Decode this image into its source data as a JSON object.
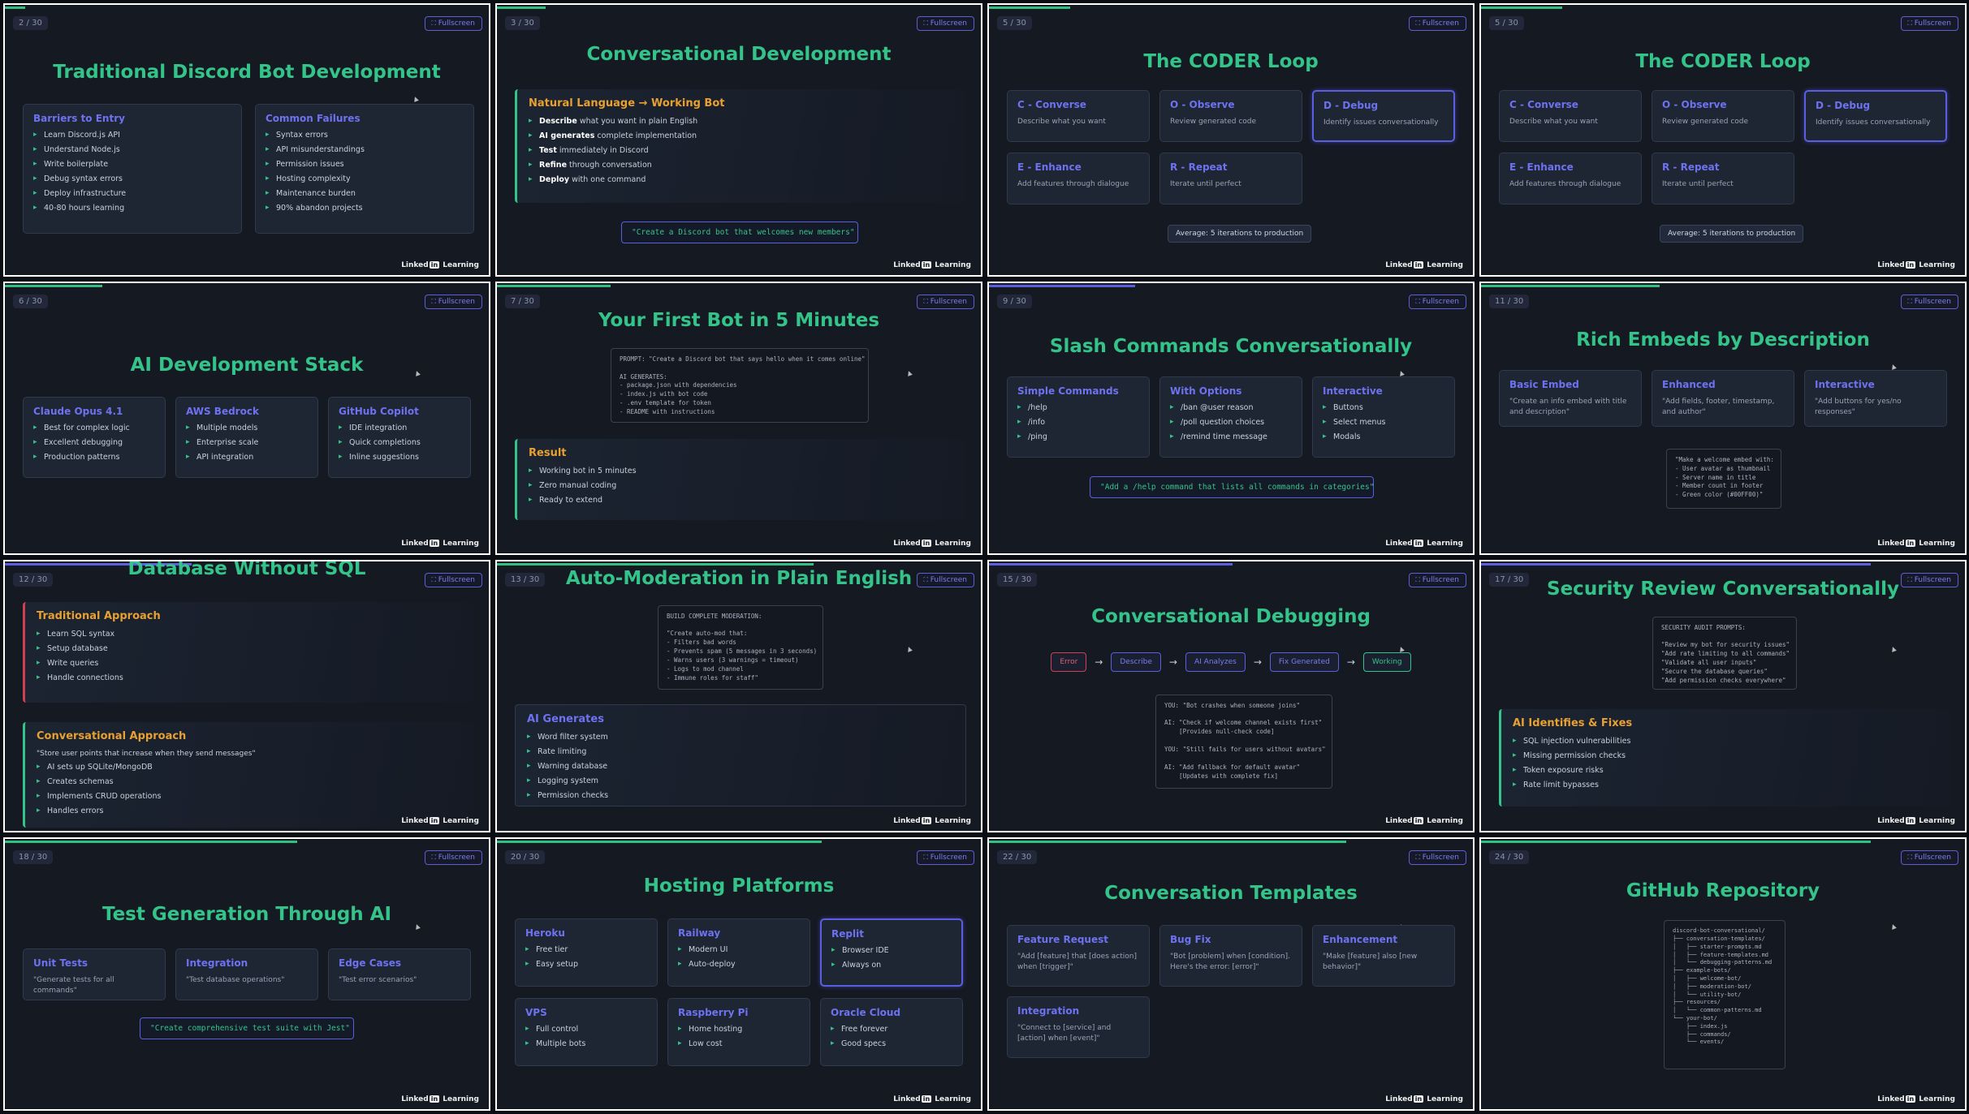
{
  "fullscreen_label": "Fullscreen",
  "brand": {
    "left": "Linked",
    "in": "in",
    "right": "Learning"
  },
  "slides": [
    {
      "num": "2 / 30",
      "title": "Traditional Discord Bot Development",
      "cards": [
        {
          "title": "Barriers to Entry",
          "items": [
            "Learn Discord.js API",
            "Understand Node.js",
            "Write boilerplate",
            "Debug syntax errors",
            "Deploy infrastructure",
            "40-80 hours learning"
          ]
        },
        {
          "title": "Common Failures",
          "items": [
            "Syntax errors",
            "API misunderstandings",
            "Permission issues",
            "Hosting complexity",
            "Maintenance burden",
            "90% abandon projects"
          ]
        }
      ]
    },
    {
      "num": "3 / 30",
      "title": "Conversational Development",
      "panel_title": "Natural Language → Working Bot",
      "items": [
        {
          "b": "Describe",
          "t": " what you want in plain English"
        },
        {
          "b": "AI generates",
          "t": " complete implementation"
        },
        {
          "b": "Test",
          "t": " immediately in Discord"
        },
        {
          "b": "Refine",
          "t": " through conversation"
        },
        {
          "b": "Deploy",
          "t": " with one command"
        }
      ],
      "prompt": "\"Create a Discord bot that welcomes new members\""
    },
    {
      "num": "5 / 30",
      "title": "The CODER Loop",
      "cards": [
        {
          "title": "C - Converse",
          "desc": "Describe what you want"
        },
        {
          "title": "O - Observe",
          "desc": "Review generated code"
        },
        {
          "title": "D - Debug",
          "desc": "Identify issues conversationally"
        },
        {
          "title": "E - Enhance",
          "desc": "Add features through dialogue"
        },
        {
          "title": "R - Repeat",
          "desc": "Iterate until perfect"
        }
      ],
      "chip": "Average: 5 iterations to production"
    },
    {
      "num": "5 / 30",
      "title": "The CODER Loop",
      "cards": [
        {
          "title": "C - Converse",
          "desc": "Describe what you want"
        },
        {
          "title": "O - Observe",
          "desc": "Review generated code"
        },
        {
          "title": "D - Debug",
          "desc": "Identify issues conversationally"
        },
        {
          "title": "E - Enhance",
          "desc": "Add features through dialogue"
        },
        {
          "title": "R - Repeat",
          "desc": "Iterate until perfect"
        }
      ],
      "chip": "Average: 5 iterations to production"
    },
    {
      "num": "6 / 30",
      "title": "AI Development Stack",
      "cards": [
        {
          "title": "Claude Opus 4.1",
          "items": [
            "Best for complex logic",
            "Excellent debugging",
            "Production patterns"
          ]
        },
        {
          "title": "AWS Bedrock",
          "items": [
            "Multiple models",
            "Enterprise scale",
            "API integration"
          ]
        },
        {
          "title": "GitHub Copilot",
          "items": [
            "IDE integration",
            "Quick completions",
            "Inline suggestions"
          ]
        }
      ]
    },
    {
      "num": "7 / 30",
      "title": "Your First Bot in 5 Minutes",
      "code": "PROMPT: \"Create a Discord bot that says hello when it comes online\"\n\nAI GENERATES:\n- package.json with dependencies\n- index.js with bot code\n- .env template for token\n- README with instructions",
      "panel_title": "Result",
      "items": [
        "Working bot in 5 minutes",
        "Zero manual coding",
        "Ready to extend"
      ]
    },
    {
      "num": "9 / 30",
      "title": "Slash Commands Conversationally",
      "cards": [
        {
          "title": "Simple Commands",
          "items": [
            "/help",
            "/info",
            "/ping"
          ]
        },
        {
          "title": "With Options",
          "items": [
            "/ban @user reason",
            "/poll question choices",
            "/remind time message"
          ]
        },
        {
          "title": "Interactive",
          "items": [
            "Buttons",
            "Select menus",
            "Modals"
          ]
        }
      ],
      "prompt": "\"Add a /help command that lists all commands in categories\""
    },
    {
      "num": "11 / 30",
      "title": "Rich Embeds by Description",
      "cards": [
        {
          "title": "Basic Embed",
          "desc": "\"Create an info embed with title and description\""
        },
        {
          "title": "Enhanced",
          "desc": "\"Add fields, footer, timestamp, and author\""
        },
        {
          "title": "Interactive",
          "desc": "\"Add buttons for yes/no responses\""
        }
      ],
      "code": "\"Make a welcome embed with:\n- User avatar as thumbnail\n- Server name in title\n- Member count in footer\n- Green color (#00FF00)\""
    },
    {
      "num": "12 / 30",
      "title": "Database Without SQL",
      "p1_title": "Traditional Approach",
      "p1_items": [
        "Learn SQL syntax",
        "Setup database",
        "Write queries",
        "Handle connections"
      ],
      "p2_title": "Conversational Approach",
      "p2_quote": "\"Store user points that increase when they send messages\"",
      "p2_items": [
        "AI sets up SQLite/MongoDB",
        "Creates schemas",
        "Implements CRUD operations",
        "Handles errors"
      ]
    },
    {
      "num": "13 / 30",
      "title": "Auto-Moderation in Plain English",
      "code": "BUILD COMPLETE MODERATION:\n\n\"Create auto-mod that:\n- Filters bad words\n- Prevents spam (5 messages in 3 seconds)\n- Warns users (3 warnings = timeout)\n- Logs to mod channel\n- Immune roles for staff\"",
      "panel_title": "AI Generates",
      "items": [
        "Word filter system",
        "Rate limiting",
        "Warning database",
        "Logging system",
        "Permission checks"
      ]
    },
    {
      "num": "15 / 30",
      "title": "Conversational Debugging",
      "flow": [
        "Error",
        "Describe",
        "AI Analyzes",
        "Fix Generated",
        "Working"
      ],
      "code": "YOU: \"Bot crashes when someone joins\"\n\nAI: \"Check if welcome channel exists first\"\n    [Provides null-check code]\n\nYOU: \"Still fails for users without avatars\"\n\nAI: \"Add fallback for default avatar\"\n    [Updates with complete fix]"
    },
    {
      "num": "17 / 30",
      "title": "Security Review Conversationally",
      "code": "SECURITY AUDIT PROMPTS:\n\n\"Review my bot for security issues\"\n\"Add rate limiting to all commands\"\n\"Validate all user inputs\"\n\"Secure the database queries\"\n\"Add permission checks everywhere\"",
      "panel_title": "AI Identifies & Fixes",
      "items": [
        "SQL injection vulnerabilities",
        "Missing permission checks",
        "Token exposure risks",
        "Rate limit bypasses"
      ]
    },
    {
      "num": "18 / 30",
      "title": "Test Generation Through AI",
      "cards": [
        {
          "title": "Unit Tests",
          "desc": "\"Generate tests for all commands\""
        },
        {
          "title": "Integration",
          "desc": "\"Test database operations\""
        },
        {
          "title": "Edge Cases",
          "desc": "\"Test error scenarios\""
        }
      ],
      "prompt": "\"Create comprehensive test suite with Jest\""
    },
    {
      "num": "20 / 30",
      "title": "Hosting Platforms",
      "cards": [
        {
          "title": "Heroku",
          "items": [
            "Free tier",
            "Easy setup"
          ]
        },
        {
          "title": "Railway",
          "items": [
            "Modern UI",
            "Auto-deploy"
          ]
        },
        {
          "title": "Replit",
          "items": [
            "Browser IDE",
            "Always on"
          ]
        },
        {
          "title": "VPS",
          "items": [
            "Full control",
            "Multiple bots"
          ]
        },
        {
          "title": "Raspberry Pi",
          "items": [
            "Home hosting",
            "Low cost"
          ]
        },
        {
          "title": "Oracle Cloud",
          "items": [
            "Free forever",
            "Good specs"
          ]
        }
      ]
    },
    {
      "num": "22 / 30",
      "title": "Conversation Templates",
      "cards": [
        {
          "title": "Feature Request",
          "desc": "\"Add [feature] that [does action] when [trigger]\""
        },
        {
          "title": "Bug Fix",
          "desc": "\"Bot [problem] when [condition]. Here's the error: [error]\""
        },
        {
          "title": "Enhancement",
          "desc": "\"Make [feature] also [new behavior]\""
        },
        {
          "title": "Integration",
          "desc": "\"Connect to [service] and [action] when [event]\""
        }
      ]
    },
    {
      "num": "24 / 30",
      "title": "GitHub Repository",
      "code": "discord-bot-conversational/\n├── conversation-templates/\n│   ├── starter-prompts.md\n│   ├── feature-templates.md\n│   └── debugging-patterns.md\n├── example-bots/\n│   ├── welcome-bot/\n│   ├── moderation-bot/\n│   └── utility-bot/\n├── resources/\n│   └── common-patterns.md\n└── your-bot/\n    ├── index.js\n    ├── commands/\n    └── events/"
    }
  ]
}
